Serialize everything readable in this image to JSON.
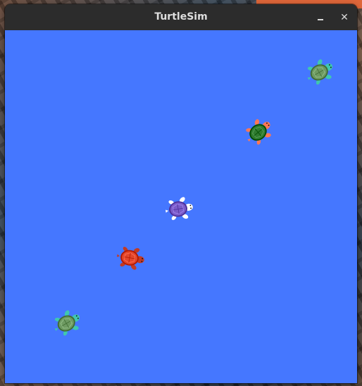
{
  "window": {
    "title": "TurtleSim",
    "close_glyph": "✕"
  },
  "canvas": {
    "background_color": "#4577ff"
  },
  "turtles": [
    {
      "id": "turtle-top-right",
      "shell": "#6e9a62",
      "limb": "#3fc7b0",
      "heading_deg": -30
    },
    {
      "id": "turtle-green-dark",
      "shell": "#2f7a2f",
      "limb": "#ff7755",
      "heading_deg": -40
    },
    {
      "id": "turtle-purple",
      "shell": "#7b5cc9",
      "limb": "#ffffff",
      "heading_deg": -10
    },
    {
      "id": "turtle-red",
      "shell": "#e2462c",
      "limb": "#c23a24",
      "heading_deg": 10
    },
    {
      "id": "turtle-bottom-left",
      "shell": "#6e9a62",
      "limb": "#3fc7b0",
      "heading_deg": -30
    }
  ]
}
